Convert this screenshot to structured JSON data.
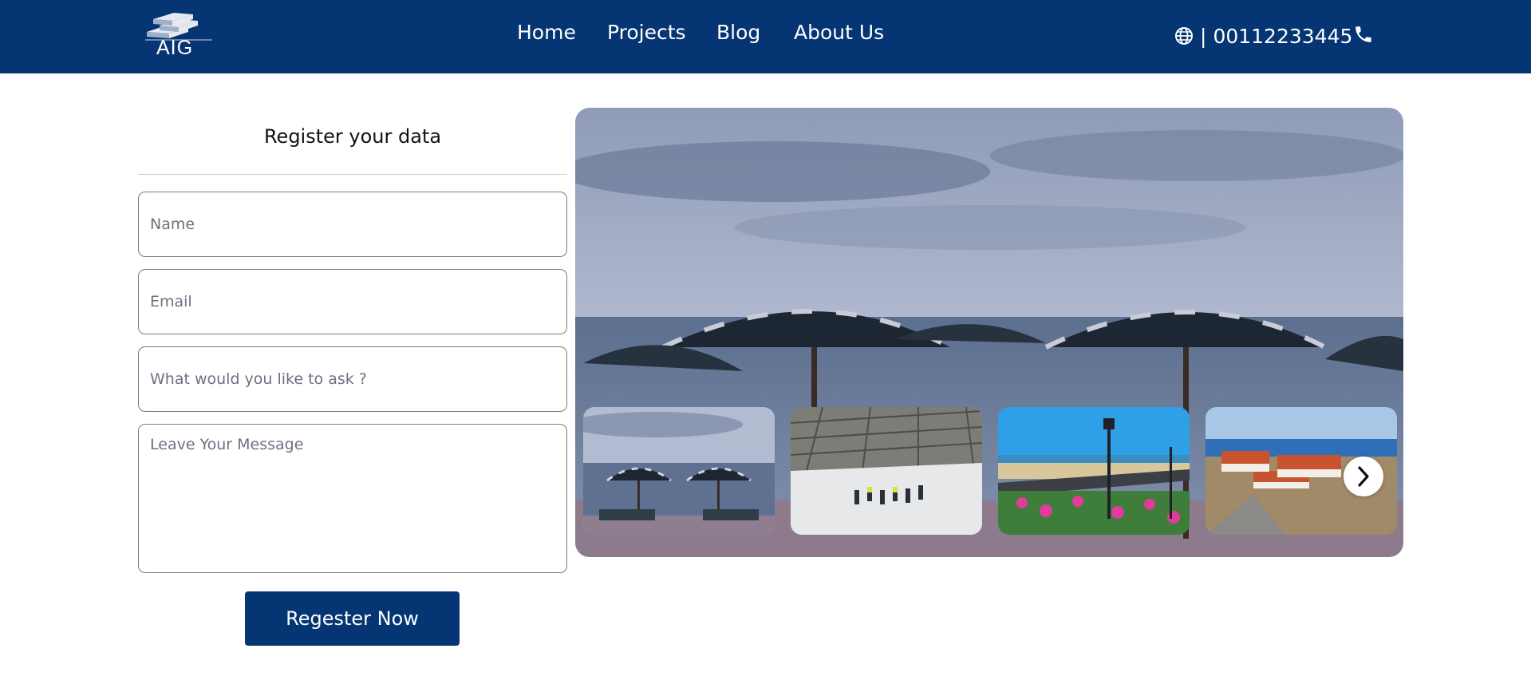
{
  "header": {
    "logo_text": "AIG",
    "logo_icon": "building-logo",
    "nav": [
      "Home",
      "Projects",
      "Blog",
      "About Us"
    ],
    "language_icon": "globe-icon",
    "separator": "|",
    "phone": "00112233445",
    "phone_icon": "phone-icon",
    "background": "#063574"
  },
  "form": {
    "title": "Register your data",
    "name_placeholder": "Name",
    "email_placeholder": "Email",
    "ask_placeholder": "What would you like to ask ?",
    "message_placeholder": "Leave Your Message",
    "submit_label": "Regester Now"
  },
  "gallery": {
    "main_image": "beach-umbrellas",
    "thumbnails": [
      "beach-umbrellas",
      "construction-site",
      "coastal-road-flowers",
      "seaside-resort"
    ],
    "next_icon": "chevron-right-icon"
  }
}
